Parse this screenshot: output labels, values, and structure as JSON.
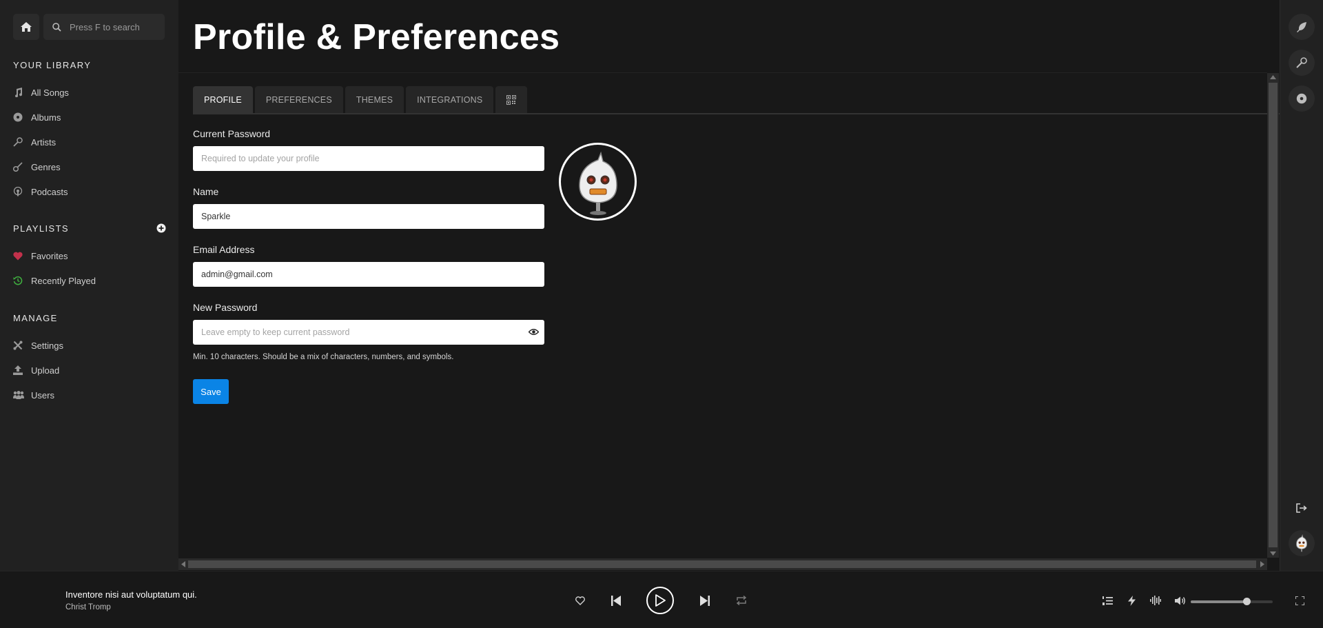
{
  "search": {
    "placeholder": "Press F to search"
  },
  "sidebar": {
    "library_heading": "YOUR LIBRARY",
    "library_items": [
      {
        "label": "All Songs",
        "icon": "music-note-icon"
      },
      {
        "label": "Albums",
        "icon": "disc-icon"
      },
      {
        "label": "Artists",
        "icon": "microphone-icon"
      },
      {
        "label": "Genres",
        "icon": "guitar-icon"
      },
      {
        "label": "Podcasts",
        "icon": "podcast-icon"
      }
    ],
    "playlists_heading": "PLAYLISTS",
    "playlist_items": [
      {
        "label": "Favorites",
        "icon": "heart-icon",
        "color": "#c2314b"
      },
      {
        "label": "Recently Played",
        "icon": "history-icon",
        "color": "#3fae3f"
      }
    ],
    "manage_heading": "MANAGE",
    "manage_items": [
      {
        "label": "Settings",
        "icon": "tools-icon"
      },
      {
        "label": "Upload",
        "icon": "upload-icon"
      },
      {
        "label": "Users",
        "icon": "users-icon"
      }
    ]
  },
  "main": {
    "title": "Profile & Preferences",
    "tabs": [
      {
        "label": "PROFILE",
        "active": true
      },
      {
        "label": "PREFERENCES",
        "active": false
      },
      {
        "label": "THEMES",
        "active": false
      },
      {
        "label": "INTEGRATIONS",
        "active": false
      },
      {
        "label": "",
        "icon": "qr-code-icon",
        "active": false
      }
    ],
    "form": {
      "current_password": {
        "label": "Current Password",
        "value": "",
        "placeholder": "Required to update your profile"
      },
      "name": {
        "label": "Name",
        "value": "Sparkle",
        "placeholder": ""
      },
      "email": {
        "label": "Email Address",
        "value": "admin@gmail.com",
        "placeholder": ""
      },
      "new_password": {
        "label": "New Password",
        "value": "",
        "placeholder": "Leave empty to keep current password"
      },
      "hint": "Min. 10 characters. Should be a mix of characters, numbers, and symbols.",
      "save_label": "Save"
    }
  },
  "player": {
    "track_title": "Inventore nisi aut voluptatum qui.",
    "artist": "Christ Tromp",
    "volume_fraction": 0.68
  },
  "colors": {
    "accent": "#0a84e6",
    "favorite": "#c2314b",
    "recent": "#3fae3f"
  }
}
